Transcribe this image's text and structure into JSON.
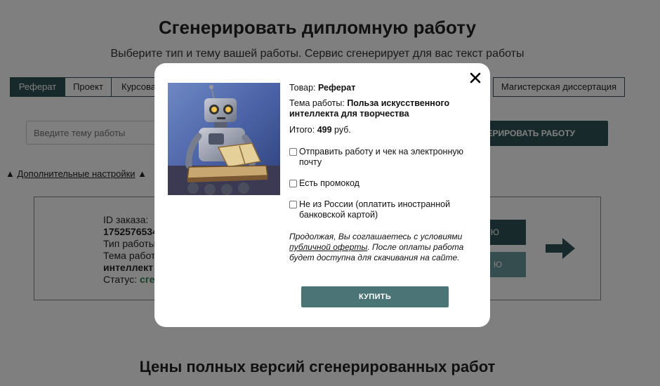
{
  "page": {
    "title": "Сгенерировать дипломную работу",
    "subtitle": "Выберите тип и тему вашей работы. Сервис сгенерирует для вас текст работы",
    "tabs": [
      {
        "label": "Реферат",
        "active": true
      },
      {
        "label": "Проект",
        "active": false
      },
      {
        "label": "Курсова",
        "active": false
      },
      {
        "label": "Магистерская диссертация",
        "active": false
      }
    ],
    "topic_placeholder": "Введите тему работы",
    "generate_button": "ЕНЕРИРОВАТЬ РАБОТУ",
    "advanced_settings": {
      "prefix": "▲ ",
      "label": "Дополнительные настройки",
      "suffix": " ▲"
    },
    "order": {
      "id_label": "ID заказа:",
      "id_value": "1752576534",
      "type_label": "Тип работы",
      "topic_label": "Тема работ",
      "topic_value": "интеллект",
      "status_label": "Статус: ",
      "status_value": "сге",
      "button1": "Ю",
      "button2": "Ю"
    },
    "prices_title": "Цены полных версий сгенерированных работ"
  },
  "modal": {
    "product_label": "Товар: ",
    "product_value": "Реферат",
    "topic_label": "Тема работы: ",
    "topic_value": "Польза искусственного интеллекта для творчества",
    "total_label": "Итого: ",
    "total_value": "499",
    "total_currency": " руб.",
    "checkboxes": {
      "email": "Отправить работу и чек на электронную почту",
      "promo": "Есть промокод",
      "foreign": "Не из России (оплатить иностранной банковской картой)"
    },
    "agreement_pre": "Продолжая, Вы соглашаетесь с условиями ",
    "agreement_link": "публичной оферты",
    "agreement_post": ". После оплаты работа будет доступна для скачивания на сайте.",
    "buy_button": "КУПИТЬ",
    "close_icon": "close-icon",
    "image_icon": "robot-reading-book-image"
  },
  "colors": {
    "primary": "#2f5254",
    "secondary": "#6a9a9c",
    "overlay": "rgba(0,0,0,0.5)",
    "status": "#2f7a4f"
  }
}
